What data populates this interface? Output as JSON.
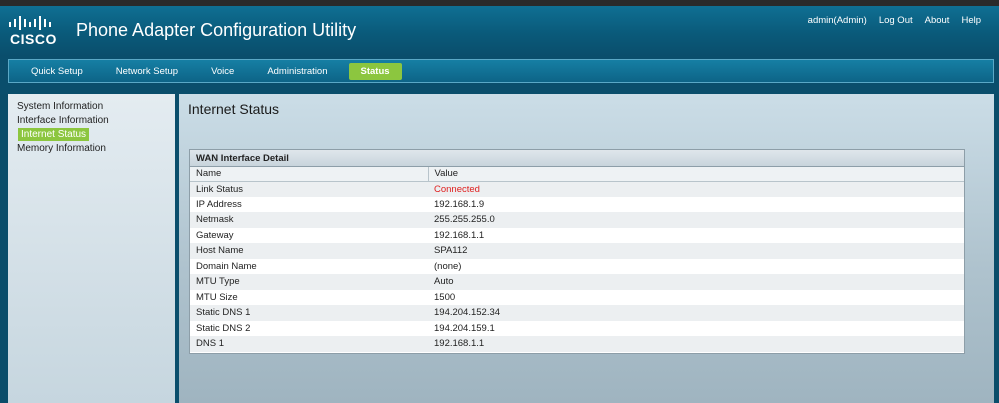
{
  "header": {
    "logo_text": "CISCO",
    "app_title": "Phone Adapter Configuration Utility",
    "links": [
      "admin(Admin)",
      "Log Out",
      "About",
      "Help"
    ]
  },
  "nav": {
    "tabs": [
      "Quick Setup",
      "Network Setup",
      "Voice",
      "Administration",
      "Status"
    ],
    "active": "Status"
  },
  "sidebar": {
    "items": [
      "System Information",
      "Interface Information",
      "Internet Status",
      "Memory Information"
    ],
    "active": "Internet Status"
  },
  "main": {
    "title": "Internet Status",
    "panel_title": "WAN Interface Detail",
    "columns": [
      "Name",
      "Value"
    ],
    "rows": [
      {
        "name": "Link Status",
        "value": "Connected"
      },
      {
        "name": "IP Address",
        "value": "192.168.1.9"
      },
      {
        "name": "Netmask",
        "value": "255.255.255.0"
      },
      {
        "name": "Gateway",
        "value": "192.168.1.1"
      },
      {
        "name": "Host Name",
        "value": "SPA112"
      },
      {
        "name": "Domain Name",
        "value": "(none)"
      },
      {
        "name": "MTU Type",
        "value": "Auto"
      },
      {
        "name": "MTU Size",
        "value": "1500"
      },
      {
        "name": "Static DNS 1",
        "value": "194.204.152.34"
      },
      {
        "name": "Static DNS 2",
        "value": "194.204.159.1"
      },
      {
        "name": "DNS 1",
        "value": "192.168.1.1"
      }
    ]
  },
  "colors": {
    "accent_green": "#8cc63f",
    "connected_red": "#e02020",
    "header_blue": "#0f6f93"
  }
}
